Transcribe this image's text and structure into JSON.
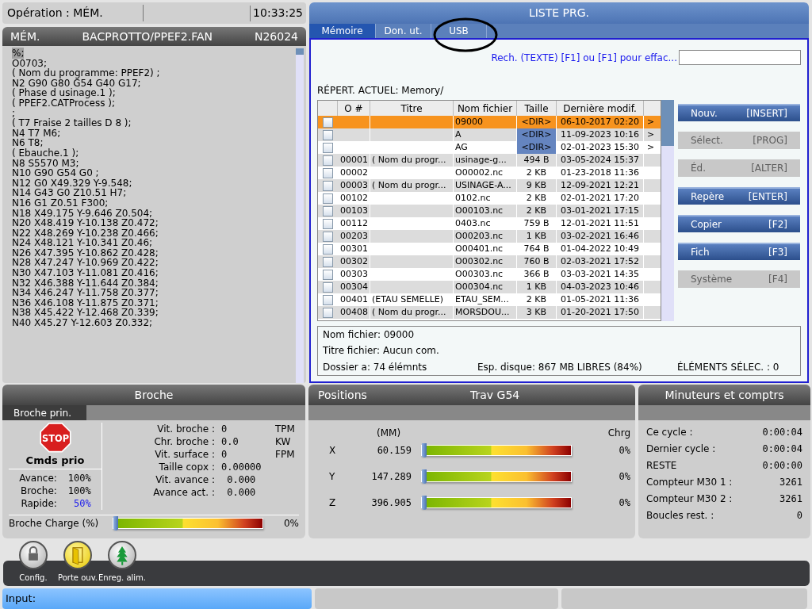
{
  "status": {
    "mode": "Opération : MÉM.",
    "time": "10:33:25"
  },
  "program": {
    "mode": "MÉM.",
    "path": "BACPROTTO/PPEF2.FAN",
    "block": "N26024",
    "lines": [
      {
        "text": "%;",
        "selected": true
      },
      {
        "text": "O0703;",
        "selected": false
      },
      {
        "text": "( Nom du programme: PPEF2) ;",
        "selected": false
      },
      {
        "text": "N2 G90 G80 G54 G40 G17;",
        "selected": false
      },
      {
        "text": "( Phase d usinage.1 );",
        "selected": false
      },
      {
        "text": "( PPEF2.CATProcess );",
        "selected": false
      },
      {
        "text": ";",
        "selected": false
      },
      {
        "text": "( T7 Fraise 2 tailles D 8 );",
        "selected": false
      },
      {
        "text": "N4 T7 M6;",
        "selected": false
      },
      {
        "text": "N6 T8;",
        "selected": false
      },
      {
        "text": "( Ebauche.1 );",
        "selected": false
      },
      {
        "text": "N8 S5570 M3;",
        "selected": false
      },
      {
        "text": "N10 G90 G54 G0 ;",
        "selected": false
      },
      {
        "text": "N12 G0 X49.329 Y-9.548;",
        "selected": false
      },
      {
        "text": "N14 G43 G0 Z10.51 H7;",
        "selected": false
      },
      {
        "text": "N16 G1 Z0.51 F300;",
        "selected": false
      },
      {
        "text": "N18 X49.175 Y-9.646 Z0.504;",
        "selected": false
      },
      {
        "text": "N20 X48.419 Y-10.138 Z0.472;",
        "selected": false
      },
      {
        "text": "N22 X48.269 Y-10.238 Z0.466;",
        "selected": false
      },
      {
        "text": "N24 X48.121 Y-10.341 Z0.46;",
        "selected": false
      },
      {
        "text": "N26 X47.395 Y-10.862 Z0.428;",
        "selected": false
      },
      {
        "text": "N28 X47.247 Y-10.969 Z0.422;",
        "selected": false
      },
      {
        "text": "N30 X47.103 Y-11.081 Z0.416;",
        "selected": false
      },
      {
        "text": "N32 X46.388 Y-11.644 Z0.384;",
        "selected": false
      },
      {
        "text": "N34 X46.247 Y-11.758 Z0.377;",
        "selected": false
      },
      {
        "text": "N36 X46.108 Y-11.875 Z0.371;",
        "selected": false
      },
      {
        "text": "N38 X45.422 Y-12.468 Z0.339;",
        "selected": false
      },
      {
        "text": "N40 X45.27 Y-12.603 Z0.332;",
        "selected": false
      }
    ]
  },
  "list": {
    "title": "LISTE PRG.",
    "tabs": [
      {
        "label": "Mémoire",
        "selected": true
      },
      {
        "label": "Don. ut.",
        "selected": false
      },
      {
        "label": "USB",
        "selected": false
      }
    ],
    "search_label": "Rech. (TEXTE) [F1] ou [F1] pour effac...",
    "current_dir": "RÉPERT. ACTUEL: Memory/",
    "columns": [
      "O #",
      "Titre",
      "Nom fichier",
      "Taille",
      "Dernière modif."
    ],
    "rows": [
      {
        "kind": "dir",
        "selected": true,
        "checked": false,
        "o": "",
        "title": "",
        "file": "09000",
        "size": "<DIR>",
        "date": "06-10-2017 02:20",
        "arrow": ">"
      },
      {
        "kind": "dir",
        "selected": false,
        "checked": false,
        "o": "",
        "title": "",
        "file": "A",
        "size": "<DIR>",
        "date": "11-09-2023 10:16",
        "arrow": ">"
      },
      {
        "kind": "dir",
        "selected": false,
        "checked": false,
        "o": "",
        "title": "",
        "file": "AG",
        "size": "<DIR>",
        "date": "02-01-2023 15:30",
        "arrow": ">"
      },
      {
        "kind": "file",
        "selected": false,
        "checked": false,
        "o": "00001",
        "title": "( Nom du progr...",
        "file": "usinage-g...",
        "size": "494 B",
        "date": "03-05-2024 15:37"
      },
      {
        "kind": "file",
        "selected": false,
        "checked": false,
        "o": "00002",
        "title": "",
        "file": "O00002.nc",
        "size": "2 KB",
        "date": "01-23-2018 11:36"
      },
      {
        "kind": "file",
        "selected": false,
        "checked": false,
        "o": "00003",
        "title": "( Nom du progr...",
        "file": "USINAGE-A...",
        "size": "9 KB",
        "date": "12-09-2021 12:21"
      },
      {
        "kind": "file",
        "selected": false,
        "checked": false,
        "o": "00102",
        "title": "",
        "file": "0102.nc",
        "size": "2 KB",
        "date": "02-01-2021 17:20"
      },
      {
        "kind": "file",
        "selected": false,
        "checked": false,
        "o": "00103",
        "title": "",
        "file": "O00103.nc",
        "size": "2 KB",
        "date": "03-01-2021 17:15"
      },
      {
        "kind": "file",
        "selected": false,
        "checked": false,
        "o": "00112",
        "title": "",
        "file": "0403.nc",
        "size": "759 B",
        "date": "12-01-2021 11:51"
      },
      {
        "kind": "file",
        "selected": false,
        "checked": false,
        "o": "00203",
        "title": "",
        "file": "O00203.nc",
        "size": "1 KB",
        "date": "03-02-2021 16:46"
      },
      {
        "kind": "file",
        "selected": false,
        "checked": false,
        "o": "00301",
        "title": "",
        "file": "O00401.nc",
        "size": "764 B",
        "date": "01-04-2022 10:49"
      },
      {
        "kind": "file",
        "selected": false,
        "checked": false,
        "o": "00302",
        "title": "",
        "file": "O00302.nc",
        "size": "760 B",
        "date": "02-03-2021 17:52"
      },
      {
        "kind": "file",
        "selected": false,
        "checked": false,
        "o": "00303",
        "title": "",
        "file": "O00303.nc",
        "size": "366 B",
        "date": "03-03-2021 14:35"
      },
      {
        "kind": "file",
        "selected": false,
        "checked": false,
        "o": "00304",
        "title": "",
        "file": "O00304.nc",
        "size": "1 KB",
        "date": "04-03-2023 10:46"
      },
      {
        "kind": "file",
        "selected": false,
        "checked": false,
        "o": "00401",
        "title": "(ETAU SEMELLE)",
        "file": "ETAU_SEM...",
        "size": "2 KB",
        "date": "01-05-2021 11:36"
      },
      {
        "kind": "file",
        "selected": false,
        "checked": false,
        "o": "00408",
        "title": "( Nom du progr...",
        "file": "MORSDOU...",
        "size": "3 KB",
        "date": "01-20-2021 17:50"
      }
    ],
    "buttons": [
      {
        "label": "Nouv.",
        "key": "[INSERT]",
        "disabled": false
      },
      {
        "label": "Sélect.",
        "key": "[PROG]",
        "disabled": true
      },
      {
        "label": "Éd.",
        "key": "[ALTER]",
        "disabled": true
      },
      {
        "label": "Repère",
        "key": "[ENTER]",
        "disabled": false
      },
      {
        "label": "Copier",
        "key": "[F2]",
        "disabled": false
      },
      {
        "label": "Fich",
        "key": "[F3]",
        "disabled": false
      },
      {
        "label": "Système",
        "key": "[F4]",
        "disabled": true
      }
    ],
    "details": {
      "file_name": "Nom fichier: 09000",
      "file_title": "Titre fichier: Aucun com.",
      "count": "Dossier a: 74 élémnts",
      "disk": "Esp. disque: 867 MB LIBRES (84%)",
      "selected_count": "ÉLÉMENTS SÉLEC. : 0"
    }
  },
  "spindle": {
    "title": "Broche",
    "tab": "Broche prin.",
    "stop_sign": "STOP",
    "stop_label": "Cmds prio",
    "overrides": [
      {
        "label": "Avance:",
        "value": "100%",
        "highlighted": false
      },
      {
        "label": "Broche:",
        "value": "100%",
        "highlighted": false
      },
      {
        "label": "Rapide:",
        "value": "50%",
        "highlighted": true
      }
    ],
    "readings": [
      {
        "label": "Vit. broche :",
        "value": "0",
        "unit": "TPM"
      },
      {
        "label": "Chr. broche :",
        "value": "0.0",
        "unit": "KW"
      },
      {
        "label": "Vit. surface :",
        "value": "0",
        "unit": "FPM"
      },
      {
        "label": "Taille copx :",
        "value": "0.00000"
      },
      {
        "label": "Vit. avance :",
        "value": " 0.000"
      },
      {
        "label": "Avance act. :",
        "value": " 0.000"
      }
    ],
    "load": {
      "label": "Broche Charge (%)",
      "level": 0,
      "reading": "0%"
    }
  },
  "positions": {
    "title": "Positions",
    "work": "Trav G54",
    "unit": "(MM)",
    "load_heading": "Chrg",
    "axes": [
      {
        "axis": "X",
        "value": "60.159",
        "level": 0,
        "reading": "0%"
      },
      {
        "axis": "Y",
        "value": "147.289",
        "level": 0,
        "reading": "0%"
      },
      {
        "axis": "Z",
        "value": "396.905",
        "level": 0,
        "reading": "0%"
      }
    ]
  },
  "timers": {
    "title": "Minuteurs et comptrs",
    "rows": [
      {
        "label": "Ce cycle :",
        "value": "0:00:04"
      },
      {
        "label": "Dernier cycle :",
        "value": "0:00:04"
      },
      {
        "label": "RESTE",
        "value": "0:00:00"
      },
      {
        "label": "Compteur M30 1 :",
        "value": "3261"
      },
      {
        "label": "Compteur M30 2 :",
        "value": "3261"
      },
      {
        "label": "Boucles rest. :",
        "value": "0"
      }
    ]
  },
  "shortcuts": [
    {
      "kind": "lock",
      "label": "Config.",
      "active": false
    },
    {
      "kind": "door",
      "label": "Porte ouv.",
      "active": true
    },
    {
      "kind": "tree",
      "label": "Enreg. alim.",
      "active": false
    }
  ],
  "input": {
    "label": "Input:"
  }
}
